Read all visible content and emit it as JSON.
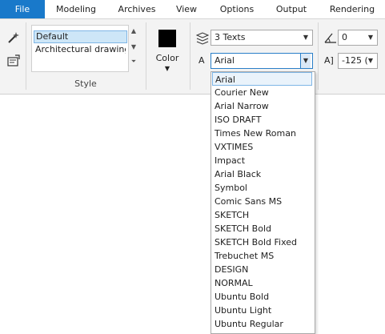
{
  "tabs": [
    {
      "label": "File"
    },
    {
      "label": "Modeling"
    },
    {
      "label": "Archives"
    },
    {
      "label": "View"
    },
    {
      "label": "Options"
    },
    {
      "label": "Output"
    },
    {
      "label": "Rendering"
    }
  ],
  "style_group": {
    "items": [
      "Default",
      "Architectural drawing"
    ],
    "selected": "Default",
    "label": "Style"
  },
  "color_group": {
    "label": "Color",
    "swatch_color": "#000000"
  },
  "text_group": {
    "texts_value": "3 Texts",
    "font_label": "A",
    "font_value": "Arial",
    "angle_value": "0",
    "size_label": "A]",
    "size_value": "-125 ("
  },
  "font_dropdown": {
    "options": [
      "Arial",
      "Courier New",
      "Arial Narrow",
      "ISO DRAFT",
      "Times New Roman",
      "VXTIMES",
      "Impact",
      "Arial Black",
      "Symbol",
      "Comic Sans MS",
      "SKETCH",
      "SKETCH Bold",
      "SKETCH Bold Fixed",
      "Trebuchet MS",
      "DESIGN",
      "NORMAL",
      "Ubuntu Bold",
      "Ubuntu Light",
      "Ubuntu Regular"
    ],
    "selected_index": 0
  },
  "colors": {
    "accent": "#1979ca",
    "selection": "#cde6f7"
  }
}
